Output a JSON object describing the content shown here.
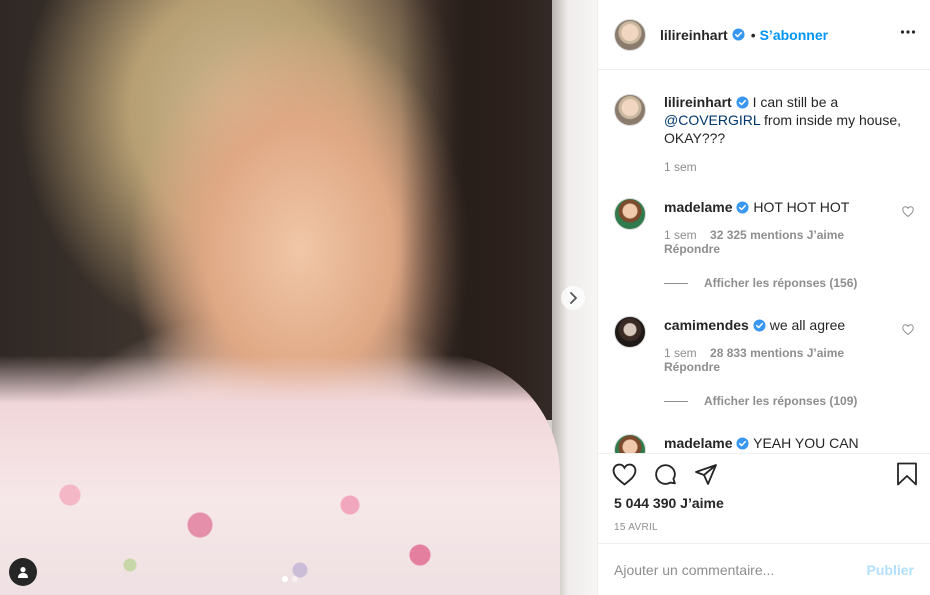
{
  "post": {
    "image_alt": "",
    "carousel": {
      "count": 2,
      "active_index": 0
    }
  },
  "header": {
    "username": "lilireinhart",
    "separator": "•",
    "follow_label": "S’abonner"
  },
  "caption": {
    "username": "lilireinhart",
    "text_before": "I can still be a ",
    "mention": "@COVERGIRL",
    "text_after": " from inside my house, OKAY???",
    "time": "1 sem"
  },
  "comments": [
    {
      "username": "madelame",
      "text": "HOT HOT HOT",
      "time": "1 sem",
      "likes": "32 325 mentions J’aime",
      "reply_label": "Répondre",
      "view_replies": "Afficher les réponses (156)"
    },
    {
      "username": "camimendes",
      "text": "we all agree",
      "time": "1 sem",
      "likes": "28 833 mentions J’aime",
      "reply_label": "Répondre",
      "view_replies": "Afficher les réponses (109)"
    },
    {
      "username": "madelame",
      "text": "YEAH YOU CAN"
    }
  ],
  "actions": {
    "likes_count": "5 044 390 J’aime",
    "date": "15 AVRIL"
  },
  "add_comment": {
    "placeholder": "Ajouter un commentaire...",
    "publish_label": "Publier"
  },
  "colors": {
    "accent": "#0095f6",
    "publish_disabled": "#b2dffc",
    "verified": "#3897f0",
    "muted": "#8e8e8e"
  }
}
